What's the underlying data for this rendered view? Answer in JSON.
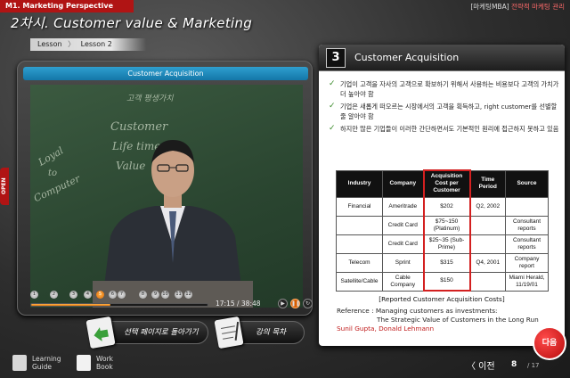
{
  "header": {
    "course": "M1. Marketing Perspective",
    "brand_prefix": "[마케팅MBA]",
    "brand_suffix": "전략적 마케팅 관리",
    "lesson_title": "2차시. Customer value & Marketing",
    "crumb_lesson": "Lesson",
    "crumb_sep": "〉",
    "crumb_current": "Lesson 2",
    "open_tab": "OPEN"
  },
  "player": {
    "title": "Customer Acquisition",
    "chalk_notes": [
      "고객 평생가치",
      "Customer",
      "Life time",
      "Value",
      "Loyal",
      "to",
      "Computer"
    ],
    "chapters": [
      "1",
      "2",
      "3",
      "4",
      "5",
      "6",
      "7",
      "8",
      "9",
      "10",
      "11",
      "12"
    ],
    "active_chapter": "5",
    "progress": 0.45,
    "time": "17:15 / 38:48",
    "play_icon": "play-icon",
    "pause_icon": "pause-icon",
    "replay_icon": "replay-icon"
  },
  "bottom": {
    "back_button": "선택 페이지로 돌아가기",
    "note_button": "강의 목차",
    "learning_guide": [
      "Learning",
      "Guide"
    ],
    "work_book": [
      "Work",
      "Book"
    ]
  },
  "slide": {
    "number": "3",
    "title": "Customer Acquisition",
    "bullets": [
      "기업이 고객을 자사의 고객으로 확보하기 위해서 사용하는 비용보다 고객의 가치가 더 높아야 함",
      "기업은 새롭게 떠오르는 시장에서의 고객을 획득하고, right customer를 선별할 줄 알아야 함",
      "하지만 많은 기업들이 이러한 간단하면서도 기본적인 원리에 접근하지 못하고 있음"
    ],
    "table": {
      "headers": [
        "Industry",
        "Company",
        "Acquisition Cost per Customer",
        "Time Period",
        "Source"
      ],
      "rows": [
        [
          "Financial",
          "Ameritrade",
          "$202",
          "Q2, 2002",
          ""
        ],
        [
          "",
          "Credit Card",
          "$75~150 (Platinum)",
          "",
          "Consultant reports"
        ],
        [
          "",
          "Credit Card",
          "$25~35 (Sub-Prime)",
          "",
          "Consultant reports"
        ],
        [
          "Telecom",
          "Sprint",
          "$315",
          "Q4, 2001",
          "Company report"
        ],
        [
          "Satellite/Cable",
          "Cable Company",
          "$150",
          "",
          "Miami Herald, 11/19/01"
        ]
      ]
    },
    "caption": "[Reported Customer Acquisition Costs]",
    "ref_label": "Reference : Managing customers as investments:",
    "ref_title": "The Strategic Value of Customers in the Long Run",
    "ref_author": "Sunil Gupta, Donald Lehmann"
  },
  "nav": {
    "prev": "〈 이전",
    "page": "8",
    "total": "/ 17",
    "next": "다음"
  },
  "colors": {
    "accent_red": "#b01414",
    "player_blue": "#1377a8",
    "highlight": "#d32020"
  }
}
